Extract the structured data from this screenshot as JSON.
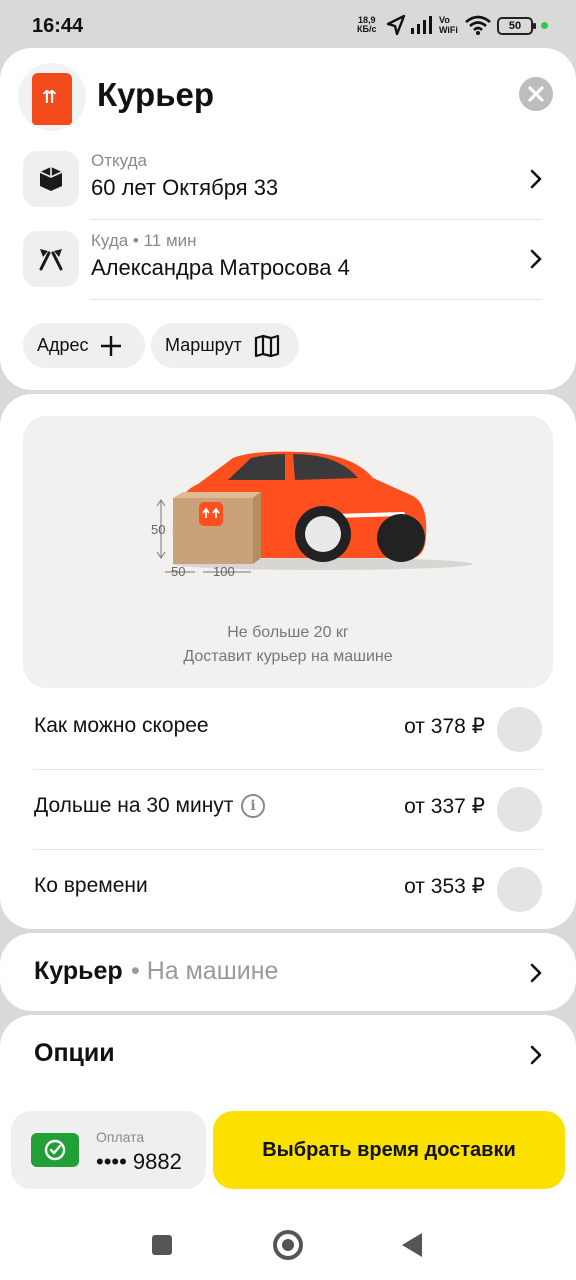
{
  "status_bar": {
    "time": "16:44",
    "speed_value": "18,9",
    "speed_unit": "КБ/с",
    "vo": "Vo",
    "wifi_label": "WiFi",
    "battery": "50"
  },
  "header": {
    "title": "Курьер",
    "logo_icon": "courier-bag-icon",
    "close_icon": "close-icon"
  },
  "route": {
    "from": {
      "label": "Откуда",
      "address": "60 лет Октября 33",
      "icon": "box-icon"
    },
    "to": {
      "label": "Куда • 11 мин",
      "address": "Александра Матросова 4",
      "icon": "flags-icon"
    }
  },
  "chips": {
    "address": {
      "label": "Адрес",
      "icon": "plus-icon"
    },
    "route": {
      "label": "Маршрут",
      "icon": "map-icon"
    }
  },
  "tariff": {
    "dims": {
      "height": "50",
      "width": "50",
      "length": "100"
    },
    "caption_weight": "Не больше 20 кг",
    "caption_delivery": "Доставит курьер на машине",
    "accent_color": "#ff4f1f"
  },
  "options": [
    {
      "name": "Как можно скорее",
      "price": "от 378 ₽",
      "info": false
    },
    {
      "name": "Дольше на 30 минут",
      "price": "от 337 ₽",
      "info": true
    },
    {
      "name": "Ко времени",
      "price": "от 353 ₽",
      "info": false
    }
  ],
  "courier_type": {
    "title": "Курьер",
    "subtitle": "• На машине"
  },
  "extra_options": {
    "title": "Опции"
  },
  "payment": {
    "label": "Оплата",
    "card": "•••• 9882",
    "badge_color": "#21a038"
  },
  "cta": {
    "label": "Выбрать время доставки",
    "color": "#fce000"
  }
}
